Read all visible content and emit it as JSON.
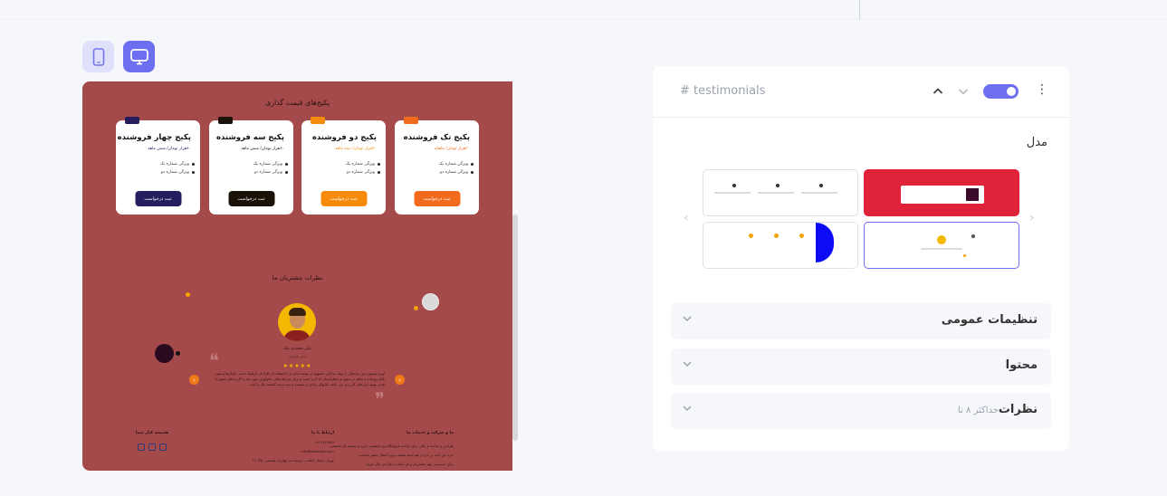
{
  "device_toggle": {
    "mobile_icon": "mobile-icon",
    "desktop_icon": "desktop-icon"
  },
  "preview": {
    "pricing_title": "پکیج‌های قیمت گذاری",
    "cards": [
      {
        "name": "پکیج تک فروشنده",
        "price": "۲۰هزار تومان/ ماهانه",
        "features": [
          "ویژگی شماره یک",
          "ویژگی شماره دو"
        ],
        "button": "ثبت درخواست",
        "color": "#f26a1b"
      },
      {
        "name": "پکیج دو فروشنده",
        "price": "۴۰هزار تومان/ نیمه ماهه",
        "features": [
          "ویژگی شماره یک",
          "ویژگی شماره دو"
        ],
        "button": "ثبت درخواست",
        "color": "#f58a0b"
      },
      {
        "name": "پکیج سه فروشنده",
        "price": "۶۰هزار تومان/ شش ماهه",
        "features": [
          "ویژگی شماره یک",
          "ویژگی شماره دو"
        ],
        "button": "ثبت درخواست",
        "color": "#1a1208"
      },
      {
        "name": "پکیج چهار فروشنده",
        "price": "۸۰هزار تومان/ شش ماهه",
        "features": [
          "ویژگی شماره یک",
          "ویژگی شماره دو"
        ],
        "button": "ثبت درخواست",
        "color": "#241d5e"
      }
    ],
    "testimonials_title": "نظرات مشتریان ما",
    "reviewer_name": "علی محمدی نیک",
    "reviewer_role": "مدیر فروش",
    "stars": "★★★★★",
    "review_text": "لورم ایپسوم متن ساختگی با تولید سادگی نامفهوم از صنعت چاپ و با استفاده از طراحان گرافیک است. چاپگرها و متون بلکه روزنامه و مجله در ستون و سطرآنچنان که لازم است و برای شرایط فعلی تکنولوژی مورد نیاز و کاربردهای متنوع با هدف بهبود ابزارهای کاربردی می باشد. کتابهای زیادی در شصت و سه درصد گذشته حال و آینده",
    "footer": {
      "about_title": "ما و شرکت و خدمات ما",
      "about_lines": [
        "طراحی و ساخت و عالی برای ساخت فروشگاه پیج تخصصی خرید و توسعه نام تخصصی",
        "خرید این ایده بی کرد از هم جدید تخفیف ویژه اعمال بیشتر شناخت",
        "برای دسترسی بهتر مشتریان و هر اینکه در طراحی بکار میرود"
      ],
      "contact_title": "ارتباط با ما",
      "contact_lines": [
        "۰۹۱۲۱۲۳۴۵۶۷",
        "info@example.com",
        "تهران، خیابان انقلاب، نرسیده به چهارراه ولیعصر، پلاک ۱۲"
      ],
      "social_title": "همیشه کنار شما"
    }
  },
  "panel": {
    "anchor": "# testimonials",
    "model_label": "مدل",
    "sections": [
      {
        "label": "تنظیمات عمومی",
        "sub": ""
      },
      {
        "label": "محتوا",
        "sub": ""
      },
      {
        "label": "نظرات",
        "sub": "حداکثر ۸ تا"
      }
    ]
  }
}
